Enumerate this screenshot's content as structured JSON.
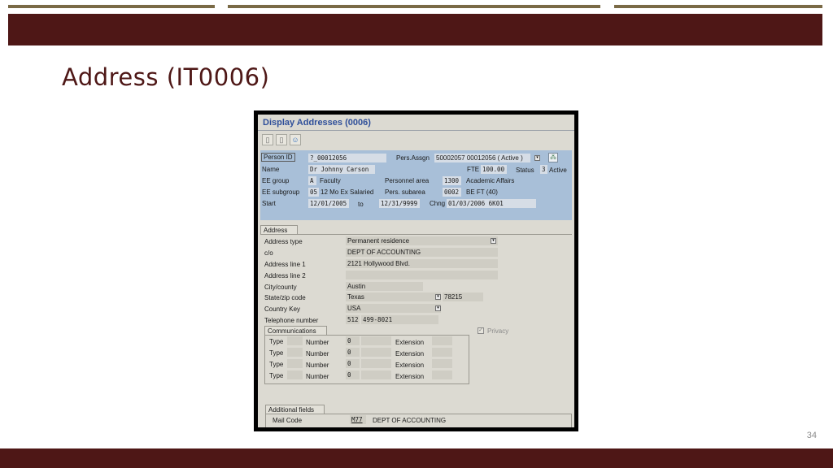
{
  "slide": {
    "title": "Address (IT0006)",
    "page_number": "34"
  },
  "colors": {
    "band": "#4e1716",
    "accent_line": "#7a6a46",
    "header_panel": "#a8bfd8"
  },
  "sap": {
    "screen_title": "Display Addresses (0006)",
    "toolbar_icons": [
      "copy-icon",
      "copy-icon",
      "person-icon"
    ],
    "header": {
      "person_id_label": "Person ID",
      "person_id_value": "?_00012056",
      "name_label": "Name",
      "name_value": "Dr  Johnny  Carson",
      "ee_group_label": "EE group",
      "ee_group_code": "A",
      "ee_group_text": "Faculty",
      "ee_subgroup_label": "EE subgroup",
      "ee_subgroup_code": "05",
      "ee_subgroup_text": "12 Mo Ex Salaried",
      "start_label": "Start",
      "start_value": "12/01/2005",
      "to_label": "to",
      "to_value": "12/31/9999",
      "pers_assign_label": "Pers.Assgn",
      "pers_assign_value": "50002057 00012056 ( Active )",
      "fte_label": "FTE",
      "fte_value": "100.00",
      "status_label": "Status",
      "status_code": "3",
      "status_text": "Active",
      "personnel_area_label": "Personnel area",
      "personnel_area_code": "1300",
      "personnel_area_text": "Academic Affairs",
      "pers_subarea_label": "Pers. subarea",
      "pers_subarea_code": "0002",
      "pers_subarea_text": "BE FT (40)",
      "chng_label": "Chng",
      "chng_value": "01/03/2006 6K01"
    },
    "address": {
      "group_label": "Address",
      "address_type_label": "Address type",
      "address_type_value": "Permanent residence",
      "co_label": "c/o",
      "co_value": "DEPT OF ACCOUNTING",
      "line1_label": "Address line 1",
      "line1_value": "2121 Hollywood Blvd.",
      "line2_label": "Address line 2",
      "line2_value": "",
      "city_label": "City/county",
      "city_value": "Austin",
      "state_label": "State/zip code",
      "state_value": "Texas",
      "zip_value": "78215",
      "country_label": "Country Key",
      "country_value": "USA",
      "phone_label": "Telephone number",
      "phone_area": "512",
      "phone_number": "499-8021",
      "privacy_label": "Privacy"
    },
    "communications": {
      "group_label": "Communications",
      "rows": [
        {
          "type_label": "Type",
          "number_label": "Number",
          "number_value": "0",
          "extension_label": "Extension"
        },
        {
          "type_label": "Type",
          "number_label": "Number",
          "number_value": "0",
          "extension_label": "Extension"
        },
        {
          "type_label": "Type",
          "number_label": "Number",
          "number_value": "0",
          "extension_label": "Extension"
        },
        {
          "type_label": "Type",
          "number_label": "Number",
          "number_value": "0",
          "extension_label": "Extension"
        }
      ]
    },
    "additional": {
      "group_label": "Additional fields",
      "mail_code_label": "Mail Code",
      "mail_code_value": "M77",
      "mail_code_text": "DEPT OF ACCOUNTING"
    }
  }
}
